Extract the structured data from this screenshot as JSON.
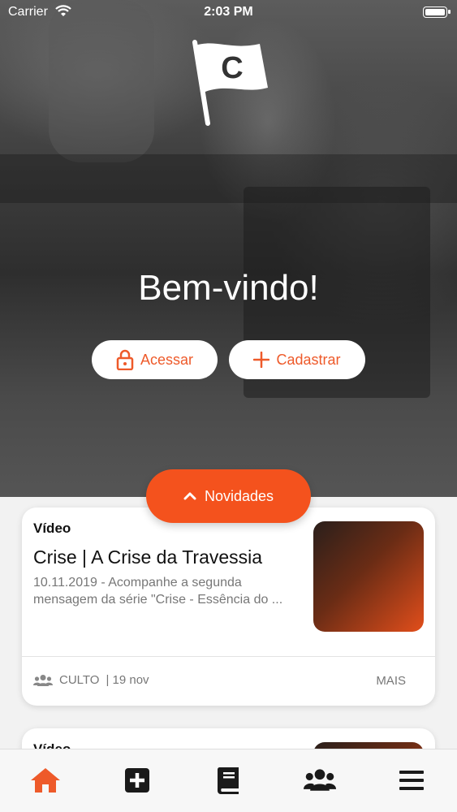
{
  "status_bar": {
    "carrier": "Carrier",
    "time": "2:03 PM"
  },
  "hero": {
    "logo_letter": "C",
    "welcome": "Bem-vindo!",
    "login_label": "Acessar",
    "signup_label": "Cadastrar"
  },
  "news_button": {
    "label": "Novidades"
  },
  "cards": [
    {
      "type": "Vídeo",
      "title": "Crise | A Crise da Travessia",
      "description": "10.11.2019 - Acompanhe a segunda mensagem da série \"Crise - Essência do ...",
      "category": "CULTO",
      "date": "| 19 nov",
      "more_label": "MAIS"
    },
    {
      "type": "Vídeo"
    }
  ],
  "tabbar": {
    "items": [
      "home-icon",
      "plus-square-icon",
      "book-icon",
      "users-icon",
      "menu-icon"
    ],
    "active_color": "#ee5a2a",
    "inactive_color": "#1a1a1a"
  },
  "colors": {
    "accent": "#f4521d"
  }
}
